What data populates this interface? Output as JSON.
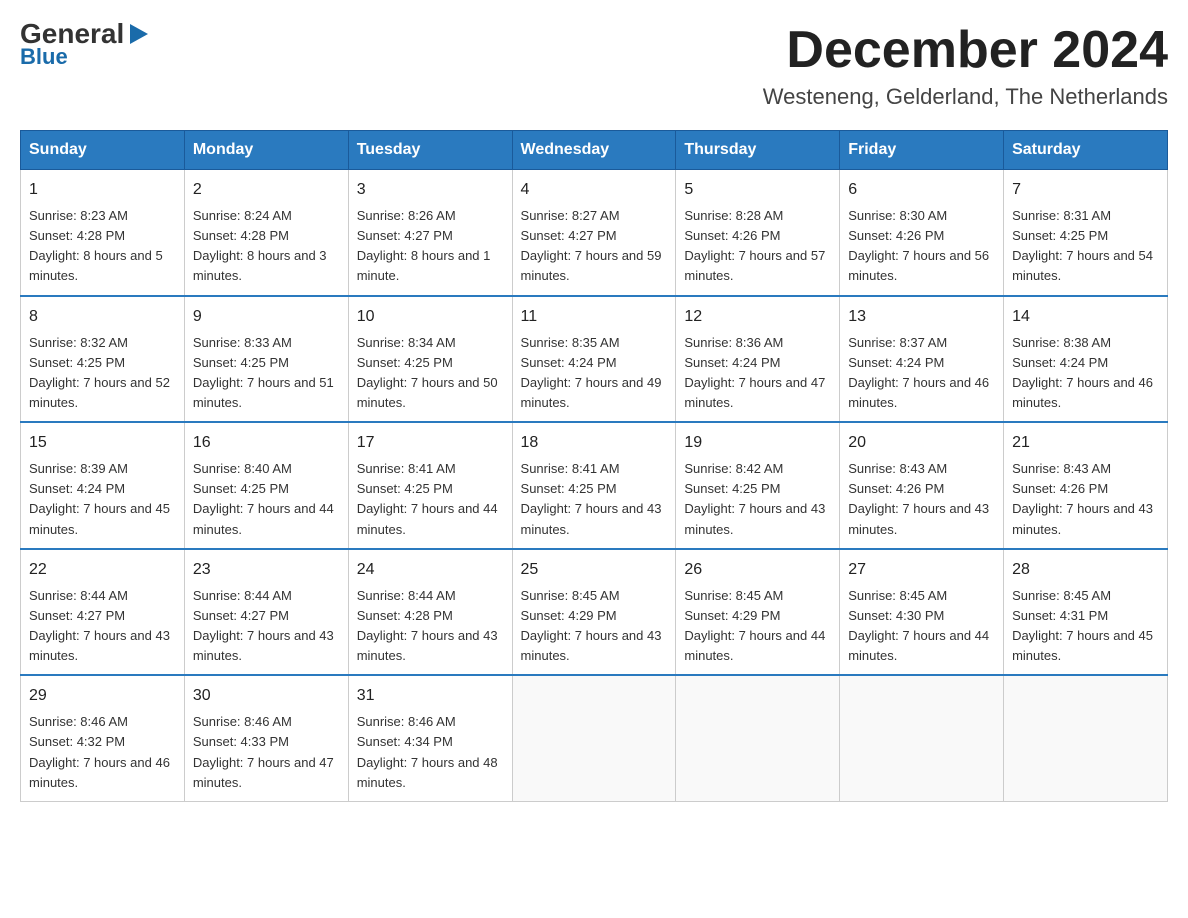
{
  "logo": {
    "general": "General",
    "blue": "Blue"
  },
  "title": {
    "month": "December 2024",
    "location": "Westeneng, Gelderland, The Netherlands"
  },
  "days_of_week": [
    "Sunday",
    "Monday",
    "Tuesday",
    "Wednesday",
    "Thursday",
    "Friday",
    "Saturday"
  ],
  "weeks": [
    [
      {
        "day": "1",
        "sunrise": "8:23 AM",
        "sunset": "4:28 PM",
        "daylight": "8 hours and 5 minutes."
      },
      {
        "day": "2",
        "sunrise": "8:24 AM",
        "sunset": "4:28 PM",
        "daylight": "8 hours and 3 minutes."
      },
      {
        "day": "3",
        "sunrise": "8:26 AM",
        "sunset": "4:27 PM",
        "daylight": "8 hours and 1 minute."
      },
      {
        "day": "4",
        "sunrise": "8:27 AM",
        "sunset": "4:27 PM",
        "daylight": "7 hours and 59 minutes."
      },
      {
        "day": "5",
        "sunrise": "8:28 AM",
        "sunset": "4:26 PM",
        "daylight": "7 hours and 57 minutes."
      },
      {
        "day": "6",
        "sunrise": "8:30 AM",
        "sunset": "4:26 PM",
        "daylight": "7 hours and 56 minutes."
      },
      {
        "day": "7",
        "sunrise": "8:31 AM",
        "sunset": "4:25 PM",
        "daylight": "7 hours and 54 minutes."
      }
    ],
    [
      {
        "day": "8",
        "sunrise": "8:32 AM",
        "sunset": "4:25 PM",
        "daylight": "7 hours and 52 minutes."
      },
      {
        "day": "9",
        "sunrise": "8:33 AM",
        "sunset": "4:25 PM",
        "daylight": "7 hours and 51 minutes."
      },
      {
        "day": "10",
        "sunrise": "8:34 AM",
        "sunset": "4:25 PM",
        "daylight": "7 hours and 50 minutes."
      },
      {
        "day": "11",
        "sunrise": "8:35 AM",
        "sunset": "4:24 PM",
        "daylight": "7 hours and 49 minutes."
      },
      {
        "day": "12",
        "sunrise": "8:36 AM",
        "sunset": "4:24 PM",
        "daylight": "7 hours and 47 minutes."
      },
      {
        "day": "13",
        "sunrise": "8:37 AM",
        "sunset": "4:24 PM",
        "daylight": "7 hours and 46 minutes."
      },
      {
        "day": "14",
        "sunrise": "8:38 AM",
        "sunset": "4:24 PM",
        "daylight": "7 hours and 46 minutes."
      }
    ],
    [
      {
        "day": "15",
        "sunrise": "8:39 AM",
        "sunset": "4:24 PM",
        "daylight": "7 hours and 45 minutes."
      },
      {
        "day": "16",
        "sunrise": "8:40 AM",
        "sunset": "4:25 PM",
        "daylight": "7 hours and 44 minutes."
      },
      {
        "day": "17",
        "sunrise": "8:41 AM",
        "sunset": "4:25 PM",
        "daylight": "7 hours and 44 minutes."
      },
      {
        "day": "18",
        "sunrise": "8:41 AM",
        "sunset": "4:25 PM",
        "daylight": "7 hours and 43 minutes."
      },
      {
        "day": "19",
        "sunrise": "8:42 AM",
        "sunset": "4:25 PM",
        "daylight": "7 hours and 43 minutes."
      },
      {
        "day": "20",
        "sunrise": "8:43 AM",
        "sunset": "4:26 PM",
        "daylight": "7 hours and 43 minutes."
      },
      {
        "day": "21",
        "sunrise": "8:43 AM",
        "sunset": "4:26 PM",
        "daylight": "7 hours and 43 minutes."
      }
    ],
    [
      {
        "day": "22",
        "sunrise": "8:44 AM",
        "sunset": "4:27 PM",
        "daylight": "7 hours and 43 minutes."
      },
      {
        "day": "23",
        "sunrise": "8:44 AM",
        "sunset": "4:27 PM",
        "daylight": "7 hours and 43 minutes."
      },
      {
        "day": "24",
        "sunrise": "8:44 AM",
        "sunset": "4:28 PM",
        "daylight": "7 hours and 43 minutes."
      },
      {
        "day": "25",
        "sunrise": "8:45 AM",
        "sunset": "4:29 PM",
        "daylight": "7 hours and 43 minutes."
      },
      {
        "day": "26",
        "sunrise": "8:45 AM",
        "sunset": "4:29 PM",
        "daylight": "7 hours and 44 minutes."
      },
      {
        "day": "27",
        "sunrise": "8:45 AM",
        "sunset": "4:30 PM",
        "daylight": "7 hours and 44 minutes."
      },
      {
        "day": "28",
        "sunrise": "8:45 AM",
        "sunset": "4:31 PM",
        "daylight": "7 hours and 45 minutes."
      }
    ],
    [
      {
        "day": "29",
        "sunrise": "8:46 AM",
        "sunset": "4:32 PM",
        "daylight": "7 hours and 46 minutes."
      },
      {
        "day": "30",
        "sunrise": "8:46 AM",
        "sunset": "4:33 PM",
        "daylight": "7 hours and 47 minutes."
      },
      {
        "day": "31",
        "sunrise": "8:46 AM",
        "sunset": "4:34 PM",
        "daylight": "7 hours and 48 minutes."
      },
      null,
      null,
      null,
      null
    ]
  ]
}
